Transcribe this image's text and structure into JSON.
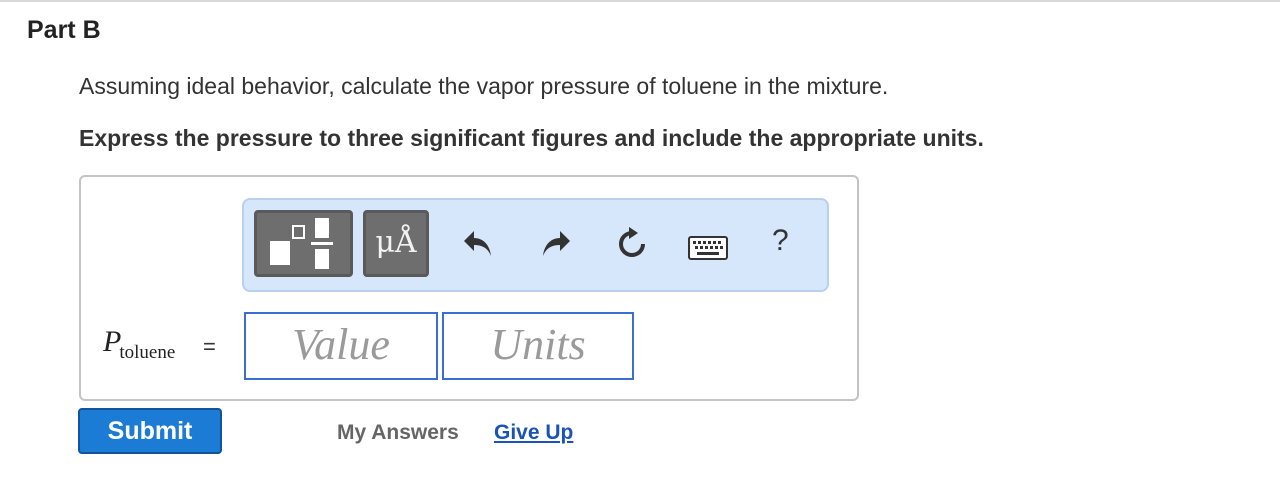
{
  "part": {
    "title": "Part B"
  },
  "question": {
    "text": "Assuming ideal behavior, calculate the vapor pressure of toluene in the mixture.",
    "instruction": "Express the pressure to three significant figures and include the appropriate units."
  },
  "toolbar": {
    "buttons": [
      {
        "name": "templates",
        "icon": "fraction-template-icon"
      },
      {
        "name": "units",
        "label": "μÅ"
      },
      {
        "name": "undo",
        "icon": "undo-icon"
      },
      {
        "name": "redo",
        "icon": "redo-icon"
      },
      {
        "name": "reset",
        "icon": "reset-icon"
      },
      {
        "name": "keyboard",
        "icon": "keyboard-icon"
      },
      {
        "name": "help",
        "label": "?"
      }
    ],
    "units_label": "μÅ",
    "help_label": "?"
  },
  "answer": {
    "variable": "P",
    "subscript": "toluene",
    "equals": "=",
    "value_placeholder": "Value",
    "units_placeholder": "Units",
    "value": "",
    "units": ""
  },
  "actions": {
    "submit_label": "Submit",
    "my_answers_label": "My Answers",
    "give_up_label": "Give Up"
  },
  "colors": {
    "submit": "#1c7bd4",
    "toolbar_bg": "#d6e6fb",
    "input_border": "#3a6fd0",
    "link": "#1a53b8"
  }
}
